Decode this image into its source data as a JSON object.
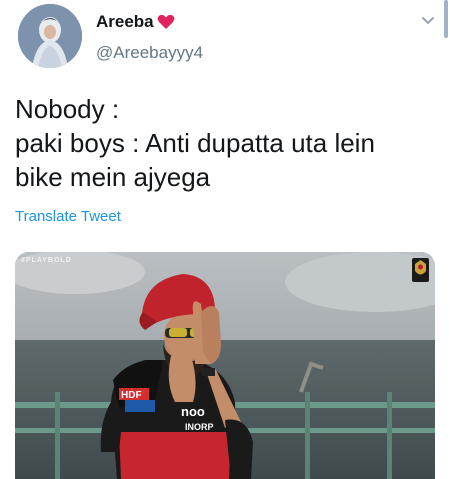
{
  "author": {
    "display_name": "Areeba",
    "handle": "@Areebayyy4"
  },
  "tweet": {
    "lines": [
      "Nobody :",
      "paki boys : Anti dupatta uta lein",
      "bike mein ajyega"
    ],
    "translate_label": "Translate Tweet"
  },
  "media": {
    "watermark": "#PLAYBOLD",
    "jersey_text_1": "HDF",
    "jersey_text_2": "noo",
    "jersey_text_3": "INORP"
  },
  "icons": {
    "heart": "red-heart-icon",
    "caret": "chevron-down-icon",
    "logo": "team-crest-icon"
  },
  "colors": {
    "link": "#1b95e0",
    "heart": "#e0245e",
    "secondary_text": "#657786"
  }
}
